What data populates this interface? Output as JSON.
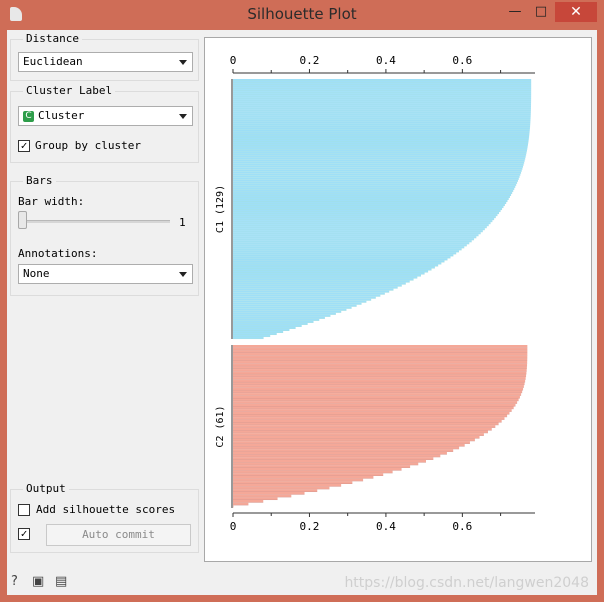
{
  "window": {
    "title": "Silhouette Plot",
    "minimize_glyph": "—",
    "maximize_glyph": "□",
    "close_glyph": "✕"
  },
  "distance": {
    "group_title": "Distance",
    "selected": "Euclidean"
  },
  "cluster_label": {
    "group_title": "Cluster Label",
    "badge": "C",
    "selected": "Cluster",
    "group_by_cluster_label": "Group by cluster",
    "group_by_cluster_checked": true,
    "check_glyph": "✓"
  },
  "bars": {
    "group_title": "Bars",
    "bar_width_label": "Bar width:",
    "bar_width_value": "1",
    "bar_width_fraction": 0.0,
    "annotations_label": "Annotations:",
    "annotations_selected": "None"
  },
  "output": {
    "group_title": "Output",
    "add_scores_label": "Add silhouette scores",
    "add_scores_checked": false,
    "auto_commit_checked": true,
    "auto_commit_label": "Auto commit"
  },
  "status_icons": [
    "help-icon",
    "save-icon",
    "report-icon"
  ],
  "status_glyphs": {
    "help": "?",
    "save": "▣",
    "report": "▤"
  },
  "watermark": "https://blog.csdn.net/langwen2048",
  "colors": {
    "cluster1": "#9fdff7",
    "cluster1_edge": "#5fc9c9",
    "cluster2": "#f5a898",
    "cluster2_edge": "#b84a3a",
    "titlebar": "#cf6d57"
  },
  "chart_data": {
    "type": "bar",
    "orientation": "horizontal",
    "xlim": [
      0,
      0.79
    ],
    "xticks": [
      "0",
      "0.2",
      "0.4",
      "0.6"
    ],
    "xtick_values": [
      0,
      0.2,
      0.4,
      0.6
    ],
    "series": [
      {
        "name": "C1 (129)",
        "count": 129,
        "max": 0.78,
        "min": 0.08
      },
      {
        "name": "C2 (61)",
        "count": 61,
        "max": 0.77,
        "min": 0.0
      }
    ]
  }
}
